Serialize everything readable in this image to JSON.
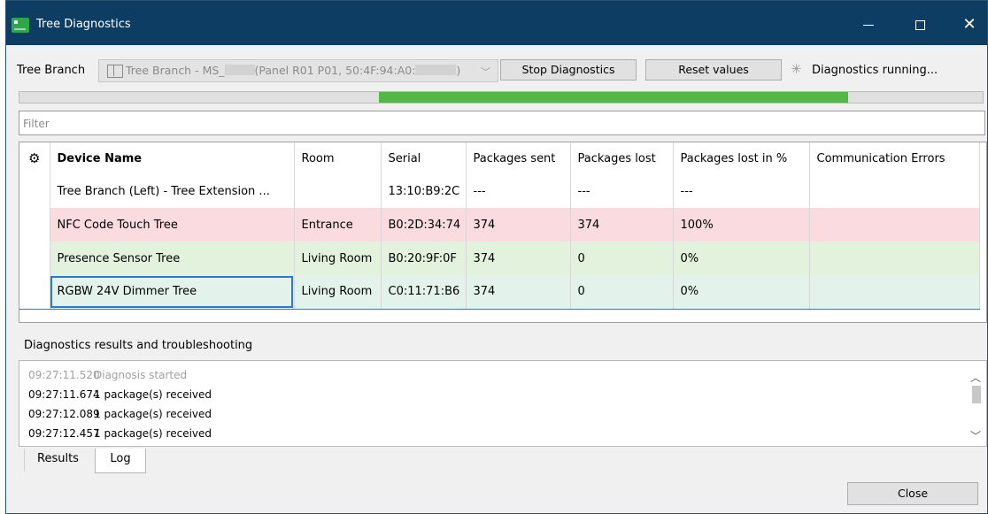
{
  "window": {
    "title": "Tree Diagnostics"
  },
  "toolbar": {
    "branch_label": "Tree Branch",
    "branch_select_prefix": "Tree Branch - MS_",
    "branch_select_middle": "(Panel R01 P01, 50:4F:94:A0:",
    "branch_select_suffix": ")",
    "stop_button": "Stop Diagnostics",
    "reset_button": "Reset values",
    "status": "Diagnostics running..."
  },
  "progress": {
    "fill_start_fraction": 0.373,
    "fill_end_fraction": 0.86
  },
  "filter": {
    "placeholder": "Filter"
  },
  "table": {
    "headers": [
      "Device Name",
      "Room",
      "Serial",
      "Packages sent",
      "Packages lost",
      "Packages lost in %",
      "Communication Errors"
    ],
    "rows": [
      {
        "status": "plain",
        "name": "Tree Branch (Left) - Tree Extension ...",
        "room": "",
        "serial": "13:10:B9:2C",
        "sent": "---",
        "lost": "---",
        "lost_pct": "---",
        "errors": ""
      },
      {
        "status": "red",
        "name": "NFC Code Touch Tree",
        "room": "Entrance",
        "serial": "B0:2D:34:74",
        "sent": "374",
        "lost": "374",
        "lost_pct": "100%",
        "errors": ""
      },
      {
        "status": "green",
        "name": "Presence Sensor Tree",
        "room": "Living Room",
        "serial": "B0:20:9F:0F",
        "sent": "374",
        "lost": "0",
        "lost_pct": "0%",
        "errors": ""
      },
      {
        "status": "selected",
        "name": "RGBW 24V Dimmer Tree",
        "room": "Living Room",
        "serial": "C0:11:71:B6",
        "sent": "374",
        "lost": "0",
        "lost_pct": "0%",
        "errors": ""
      }
    ]
  },
  "results": {
    "title": "Diagnostics results and troubleshooting",
    "log": [
      {
        "time": "09:27:11.520",
        "message": "Diagnosis started",
        "dim": true
      },
      {
        "time": "09:27:11.674",
        "message": "1 package(s) received",
        "dim": false
      },
      {
        "time": "09:27:12.089",
        "message": "1 package(s) received",
        "dim": false
      },
      {
        "time": "09:27:12.457",
        "message": "1 package(s) received",
        "dim": false
      }
    ],
    "tabs": [
      "Results",
      "Log"
    ],
    "active_tab": "Log"
  },
  "footer": {
    "close_button": "Close"
  },
  "colors": {
    "titlebar": "#0e3d63",
    "progress_fill": "#54b848",
    "row_red": "#fadbe0",
    "row_green": "#e3f2dc",
    "selection": "#2a7bd0"
  },
  "icons": {
    "app": "tree-diagnostics-icon",
    "gear": "gear-icon",
    "spinner": "spinner-icon"
  }
}
